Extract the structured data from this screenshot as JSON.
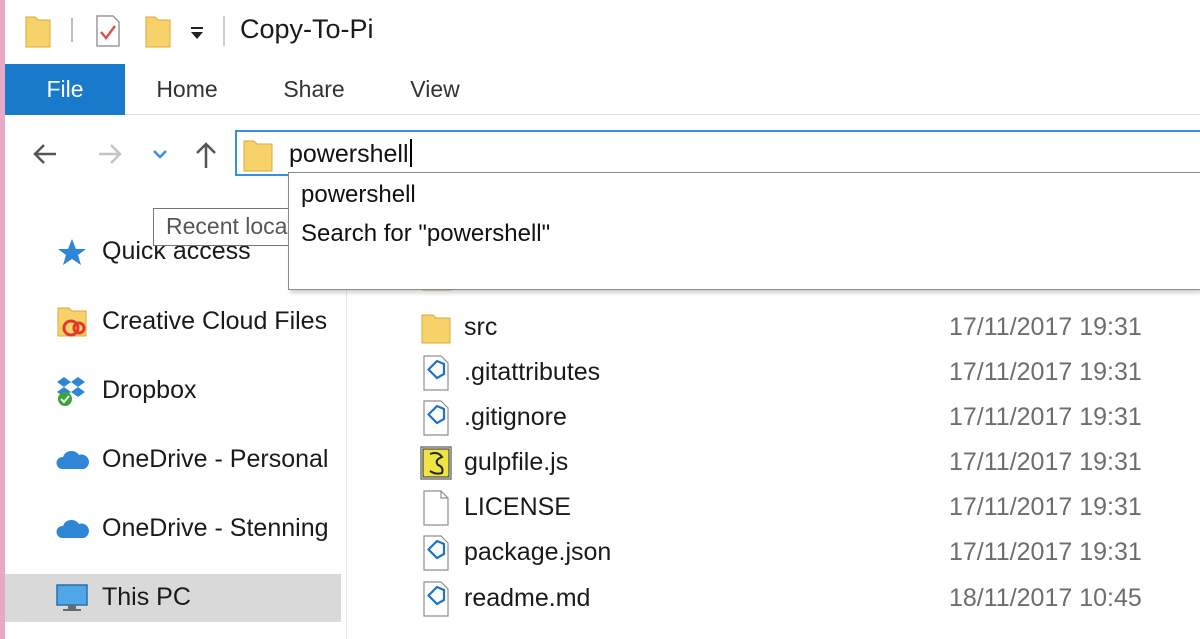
{
  "window": {
    "title": "Copy-To-Pi"
  },
  "ribbon": {
    "tabs": [
      {
        "label": "File"
      },
      {
        "label": "Home"
      },
      {
        "label": "Share"
      },
      {
        "label": "View"
      }
    ]
  },
  "address_bar": {
    "value": "powershell"
  },
  "autocomplete": {
    "items": [
      {
        "label": "powershell"
      },
      {
        "label": "Search for \"powershell\""
      }
    ]
  },
  "tooltip": {
    "text": "Recent locations"
  },
  "sidebar": {
    "items": [
      {
        "label": "Quick access",
        "icon": "star-icon"
      },
      {
        "label": "Creative Cloud Files",
        "icon": "creative-cloud-icon"
      },
      {
        "label": "Dropbox",
        "icon": "dropbox-icon"
      },
      {
        "label": "OneDrive - Personal",
        "icon": "onedrive-icon"
      },
      {
        "label": "OneDrive - Stenning",
        "icon": "onedrive-icon"
      },
      {
        "label": "This PC",
        "icon": "computer-icon",
        "selected": true
      }
    ]
  },
  "files": [
    {
      "name": "src",
      "date": "17/11/2017 19:31",
      "icon": "folder-icon"
    },
    {
      "name": ".gitattributes",
      "date": "17/11/2017 19:31",
      "icon": "vscode-file-icon"
    },
    {
      "name": ".gitignore",
      "date": "17/11/2017 19:31",
      "icon": "vscode-file-icon"
    },
    {
      "name": "gulpfile.js",
      "date": "17/11/2017 19:31",
      "icon": "js-file-icon"
    },
    {
      "name": "LICENSE",
      "date": "17/11/2017 19:31",
      "icon": "blank-file-icon"
    },
    {
      "name": "package.json",
      "date": "17/11/2017 19:31",
      "icon": "vscode-file-icon"
    },
    {
      "name": "readme.md",
      "date": "18/11/2017 10:45",
      "icon": "vscode-file-icon"
    }
  ],
  "colors": {
    "accent": "#1979ca",
    "folder": "#f7d26b",
    "selected": "#d9d9d9"
  }
}
